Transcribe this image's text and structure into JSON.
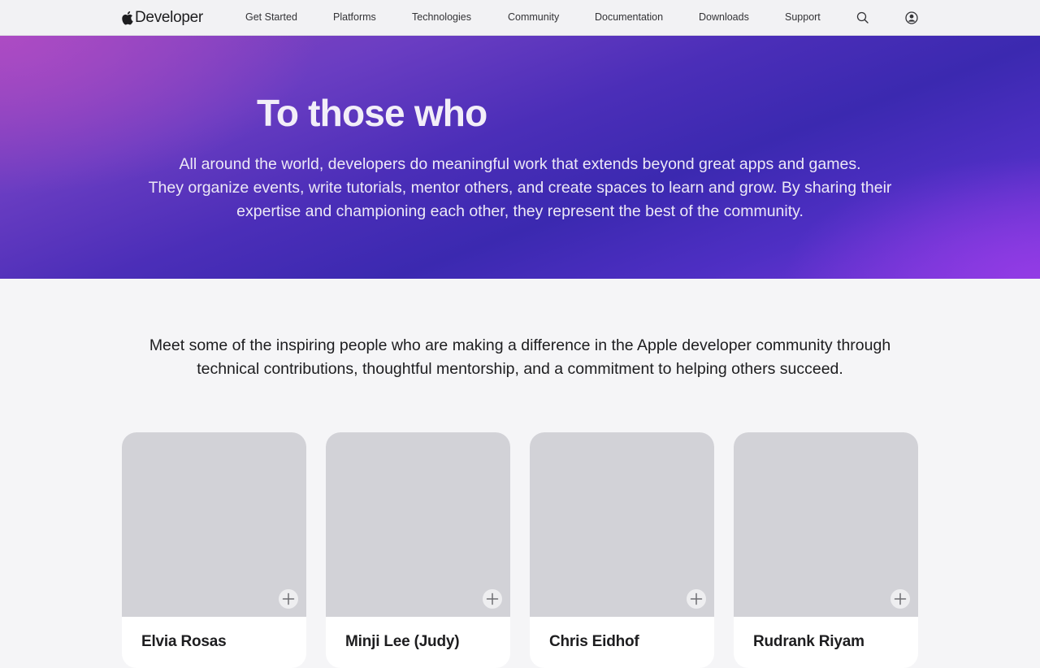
{
  "nav": {
    "logo_text": "Developer",
    "items": [
      {
        "label": "Get Started"
      },
      {
        "label": "Platforms"
      },
      {
        "label": "Technologies"
      },
      {
        "label": "Community"
      },
      {
        "label": "Documentation"
      },
      {
        "label": "Downloads"
      },
      {
        "label": "Support"
      }
    ],
    "icons": {
      "search": "search-icon",
      "account": "account-icon",
      "logo": "apple-logo-icon"
    }
  },
  "hero": {
    "title": "To those who",
    "lines": [
      "All around the world, developers do meaningful work that extends beyond great apps and games.",
      "They organize events, write tutorials, mentor others, and create spaces to learn and grow. By sharing their",
      "expertise and championing each other, they represent the best of the community."
    ],
    "colors": {
      "gradient_start": "#a24cc0",
      "gradient_mid": "#3b29b0",
      "gradient_end": "#7f36e0"
    }
  },
  "intro": {
    "lines": [
      "Meet some of the inspiring people who are making a difference in the Apple developer community through",
      "technical contributions, thoughtful mentorship, and a commitment to helping others succeed."
    ]
  },
  "cards": [
    {
      "name": "Elvia Rosas",
      "action_icon": "plus-icon"
    },
    {
      "name": "Minji Lee (Judy)",
      "action_icon": "plus-icon"
    },
    {
      "name": "Chris Eidhof",
      "action_icon": "plus-icon"
    },
    {
      "name": "Rudrank Riyam",
      "action_icon": "plus-icon"
    }
  ]
}
